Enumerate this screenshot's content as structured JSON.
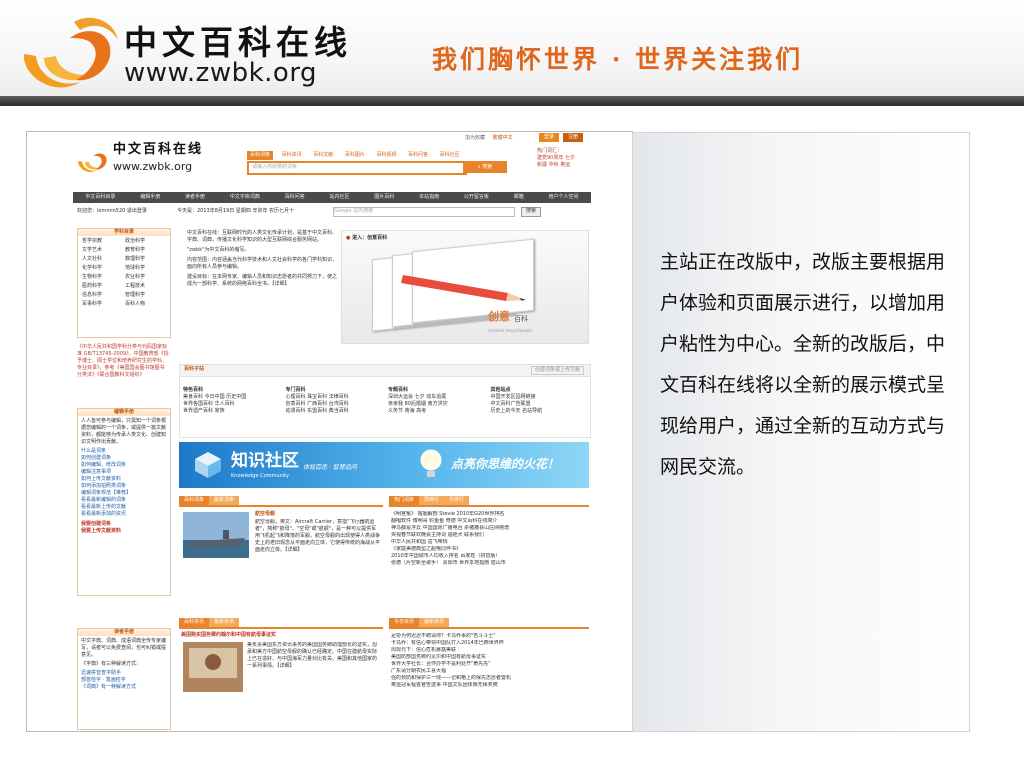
{
  "header": {
    "logo_cn": "中文百科在线",
    "logo_url": "www.zwbk.org",
    "slogan": "我们胸怀世界 · 世界关注我们"
  },
  "description": "主站正在改版中，改版主要根据用户体验和页面展示进行，以增加用户粘性为中心。全新的改版后，中文百科在线将以全新的展示模式呈现给用户，通过全新的互动方式与网民交流。",
  "site": {
    "top_links": [
      "加为收藏",
      "繁體中文"
    ],
    "login_label": "登录",
    "register_label": "注册",
    "logo_cn": "中文百科在线",
    "logo_url": "www.zwbk.org",
    "search_tabs": [
      "百科词条",
      "百科资讯",
      "百科文献",
      "百科图片",
      "百科视频",
      "百科问答",
      "百科社区"
    ],
    "search_placeholder": "请输入你想要的词条",
    "search_button": "搜索",
    "hot_search_label": "热门词汇：",
    "hot_search_words": [
      "建党90周年",
      "七夕",
      "新疆",
      "中秋",
      "奥运"
    ],
    "nav": [
      "中文百科目录",
      "编辑手册",
      "读者手册",
      "中文字库词典",
      "百科问答",
      "站内社区",
      "图片百科",
      "本站指南",
      "公开留言板",
      "邮箱",
      "用户个人空间"
    ],
    "welcome": "欢迎您：lemmin520  退出登录",
    "date_text": "今天是：2013年8月19日 星期四 辛卯年 农历七月十",
    "mini_search_placeholder": "Google 站内搜索",
    "mini_search_button": "搜索",
    "subjects_title": "学科目录",
    "subjects": [
      "哲学宗教",
      "政治科学",
      "文学艺术",
      "教育科学",
      "人文社科",
      "数理科学",
      "化学科学",
      "地球科学",
      "生物科学",
      "农业科学",
      "医药科学",
      "工程技术",
      "信息科学",
      "管理科学",
      "军事科学",
      "百科人物"
    ],
    "license_note": "《中华人民共和国学科分类与代码国家标准 GB/T13745-2009》，中国教育部《授予博士、硕士学位和培养研究生的学科、专业目录》，参考《美国国会图书馆图书分类法》《联合国教科文组织》",
    "editor_title": "编辑手册",
    "editor_intro": "人人皆可参与编辑，只需知一个词条根据您编辑的一个词条，或提供一篇文献资料，都能够为传承人类文化、创建知识文明作出贡献。",
    "editor_links": [
      "什么是词条",
      "如何创建词条",
      "如何编辑、修改词条",
      "编辑注意事项",
      "如何上传文献资料",
      "如何添加拍照类词条",
      "编辑词条规范【推荐】",
      "看看最新编辑的词条",
      "看看最新上传的文献",
      "看看最新添加的资讯"
    ],
    "create_title": "我要创建词条",
    "upload_title": "我要上传文献资料",
    "reader_title": "读者手册",
    "reader_intro": "中文字典、词典、成语词典全传专家编写，请者可以免费查阅，也可纠错或提意见。",
    "reader_links": [
      "迅速拼音查字助手",
      "部首检字 · 笔画检字",
      "《词典》有一种解读方式"
    ],
    "reader_note": "《字典》有三种解读方式：",
    "intro_paragraphs": [
      "中文百科在线：互联网时代的人类文化传承计划，是基于中文百科、字典、词典，传播文化科学知识的大型互联网综合服务网站。",
      "\"zwbk\"为中文百科的缩写。",
      "内容范围：内容涵盖当代科学技术和人文社会科学的各门学科知识，面向所有人员参与编辑。",
      "建设目标：在本网专家、编辑人员和知识志愿者的共同努力下，使之成为一部科学、系统的网络百科全书。【详细】"
    ],
    "hero_caption": "进入：创意百科",
    "hero_title": "创意",
    "hero_sub": "百科",
    "hero_en": "creative encyclopedia",
    "sites_title": "百科子站",
    "sites_more": "创建词条或上传文献",
    "site_cols": [
      {
        "title": "特色百科",
        "items": [
          "美食百科",
          "今日中国",
          "历史中国",
          "世界各国百科",
          "华人百科",
          "世界遗产百科",
          "家族"
        ]
      },
      {
        "title": "专门百科",
        "items": [
          "心理百科",
          "珠宝百科",
          "法律百科",
          "创意百科",
          "广西百科",
          "台湾百科",
          "动漫百科",
          "东盟百科",
          "典当百科"
        ]
      },
      {
        "title": "专题百科",
        "items": [
          "深圳大运会",
          "七夕",
          "动车追尾",
          "亲亲我",
          "80后婚姻",
          "南方洪灾",
          "义务节",
          "南海",
          "高考"
        ]
      },
      {
        "title": "其他站点",
        "items": [
          "中国开发区园网链接",
          "中文百科广告联盟",
          "历史上的今天",
          "名站导航"
        ]
      }
    ],
    "banner_title": "知识社区",
    "banner_en": "Knowledge Community",
    "banner_tag": "体验百态 · 智慧追问",
    "banner_slogan": "点亮你思维的火花！",
    "tab_entries": [
      "百科词条",
      "最新词条"
    ],
    "entry_title": "航空母舰",
    "entry_text": "航空母舰，英文：Aircraft Carrier，意指\"飞行器航运者\"，简称\"航母\"、\"空母\"或\"航舰\"，是一种可以提供军用飞机起飞和降落的军舰。航空母舰的出现使得人类战争史上的老旧观念从平面走向立体，它使得传统的海战从平面走向立体。【详细】",
    "tab_hot": [
      "热门词条",
      "周排行",
      "月排行"
    ],
    "hot_list": [
      "《明宫冤》 婚姻解剖 Stevie 2010年G20世界排名",
      "翻唱软件 傅明哥 豹鱼鱼 奇德 中文百科在线简介",
      "神马都是浮云 中国国际广播电台 杀猪撒县山庄网络增",
      "央视春节联欢晚会主持词 福娃犬 联系我们",
      "中华人民共和国 岳飞帝规",
      "《家庭美德典型之超哦同伴书》",
      "2010年中国城市人均收入排名 百家姓（拼音版）",
      "张德（片空新全歌手） 贵阳市 世界本地指南 眉山市"
    ],
    "tab_news": [
      "百科资讯",
      "最新资讯"
    ],
    "news_headline": "美国购买国务卿约翰尔和中国有航母事证实",
    "news_text": "美负责美国东方资讯事务的美国国务卿助理部长的证实，坦承和美方中国航空母舰的确认已经确定。中国在建航母实际上已在造好、与中国海军力量对比有关。美国和其他国家的一系列事情。【详细】",
    "tab_today": [
      "今日资讯",
      "最新资讯"
    ],
    "today_list": [
      "足协为何迟迟不聘请帅？卡马乔事的\"告斗斗士\"",
      "卡马乔：有信心带领中国队打入2014年巴西世界杯",
      "周现元下：信心危机暴露美联",
      "美国防部国务卿约见尔和中国有航母事证实",
      "世界大学社长：合作办学不是利处开\"黄先先\"",
      "广东请分期农民工喜大福",
      "强的预防和保护三一线——记和格上的保先志愿者暨机",
      "奥运冠军程首官告送事 中国文队团体赛无缘奖牌"
    ]
  }
}
